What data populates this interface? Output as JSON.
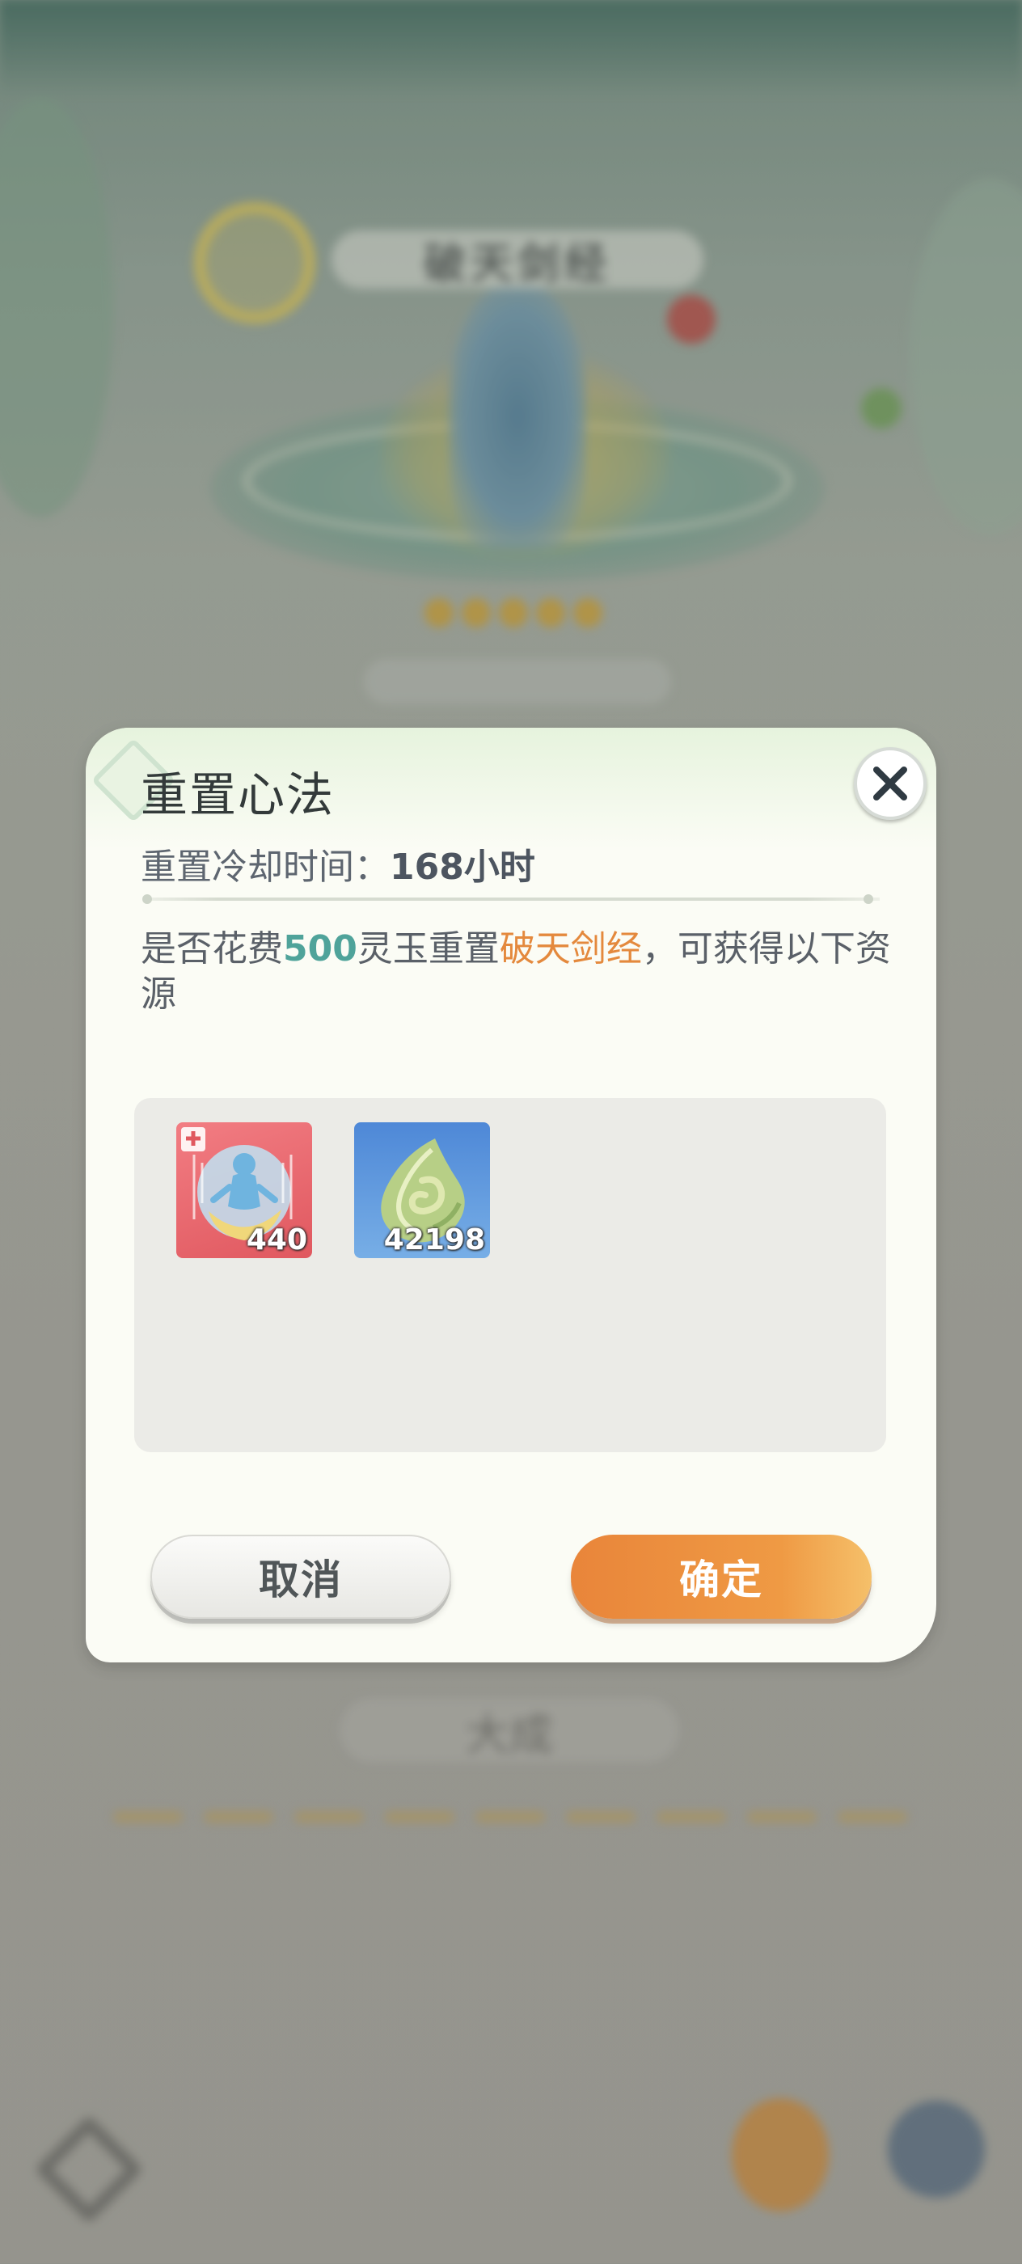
{
  "background": {
    "scene_title": "破天剑经",
    "level_label": "大成"
  },
  "dialog": {
    "title": "重置心法",
    "cooldown_label": "重置冷却时间：",
    "cooldown_value": "168小时",
    "message": {
      "part1": "是否花费",
      "cost": "500",
      "currency": "灵玉重置",
      "skill_name": "破天剑经",
      "part2": "，可获得以下资源"
    },
    "rewards": [
      {
        "icon": "skill-fragment-icon",
        "count": "440"
      },
      {
        "icon": "green-jade-icon",
        "count": "42198"
      }
    ],
    "cancel_label": "取消",
    "confirm_label": "确定",
    "colors": {
      "cost": "#4fa39a",
      "skill_name": "#e4893d",
      "confirm": "#ee8f3e"
    }
  }
}
